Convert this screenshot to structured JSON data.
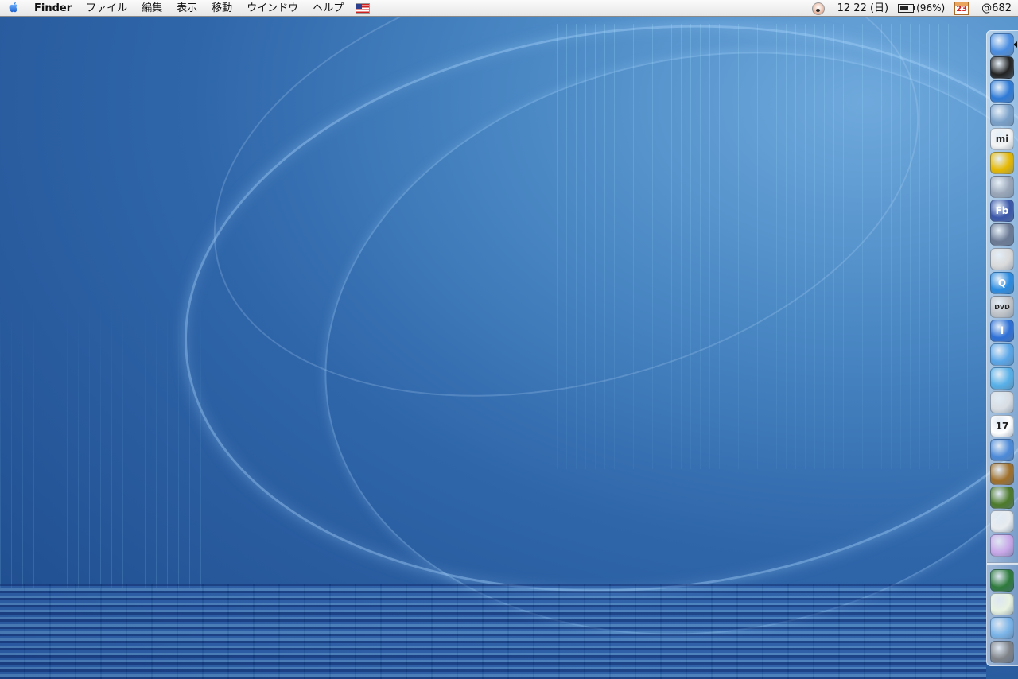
{
  "menubar": {
    "apple_label": "",
    "app_name": "Finder",
    "menus": [
      "ファイル",
      "編集",
      "表示",
      "移動",
      "ウインドウ",
      "ヘルプ"
    ],
    "clock": "12 22 (日)",
    "battery": "(96%)",
    "calendar_day": "23",
    "counter": "@682"
  },
  "dock": {
    "items": [
      {
        "name": "finder-icon",
        "color": "#4a8de0"
      },
      {
        "name": "terminal-icon",
        "color": "#222222"
      },
      {
        "name": "internet-explorer-icon",
        "color": "#2e7ad6"
      },
      {
        "name": "preview-icon",
        "color": "#7aa0c8"
      },
      {
        "name": "mi-text-editor-icon",
        "color": "#f3f3f3",
        "text": "mi"
      },
      {
        "name": "sunflower-icon",
        "color": "#e6b800"
      },
      {
        "name": "image-capture-icon",
        "color": "#9aa6b8"
      },
      {
        "name": "photoshop-icon",
        "color": "#3a56a8",
        "text": "Fb"
      },
      {
        "name": "network-utility-icon",
        "color": "#6c7a94"
      },
      {
        "name": "printer-utility-icon",
        "color": "#d9d9d9"
      },
      {
        "name": "quicktime-icon",
        "color": "#2a8be0",
        "text": "Q"
      },
      {
        "name": "dvd-player-icon",
        "color": "#c0c4c8",
        "text": "DVD"
      },
      {
        "name": "system-info-icon",
        "color": "#2d6fd6",
        "text": "i"
      },
      {
        "name": "mail-icon",
        "color": "#5aa6e8"
      },
      {
        "name": "folder-app-icon",
        "color": "#57b0e8"
      },
      {
        "name": "camera-icon",
        "color": "#d8dde2"
      },
      {
        "name": "ical-icon",
        "color": "#ffffff",
        "text": "17"
      },
      {
        "name": "messenger-icon",
        "color": "#4c8ad8"
      },
      {
        "name": "guitar-icon",
        "color": "#a0702a"
      },
      {
        "name": "tools-icon",
        "color": "#4d7a2a"
      },
      {
        "name": "apple-app-icon",
        "color": "#e8ecef"
      },
      {
        "name": "itunes-icon",
        "color": "#c9a8e8"
      },
      {
        "name": "globe-icon",
        "color": "#2d7a3a"
      },
      {
        "name": "document-icon",
        "color": "#e8f2e0"
      },
      {
        "name": "blue-folder-icon",
        "color": "#7ab4e8"
      },
      {
        "name": "trash-icon",
        "color": "#7f8388"
      }
    ]
  }
}
